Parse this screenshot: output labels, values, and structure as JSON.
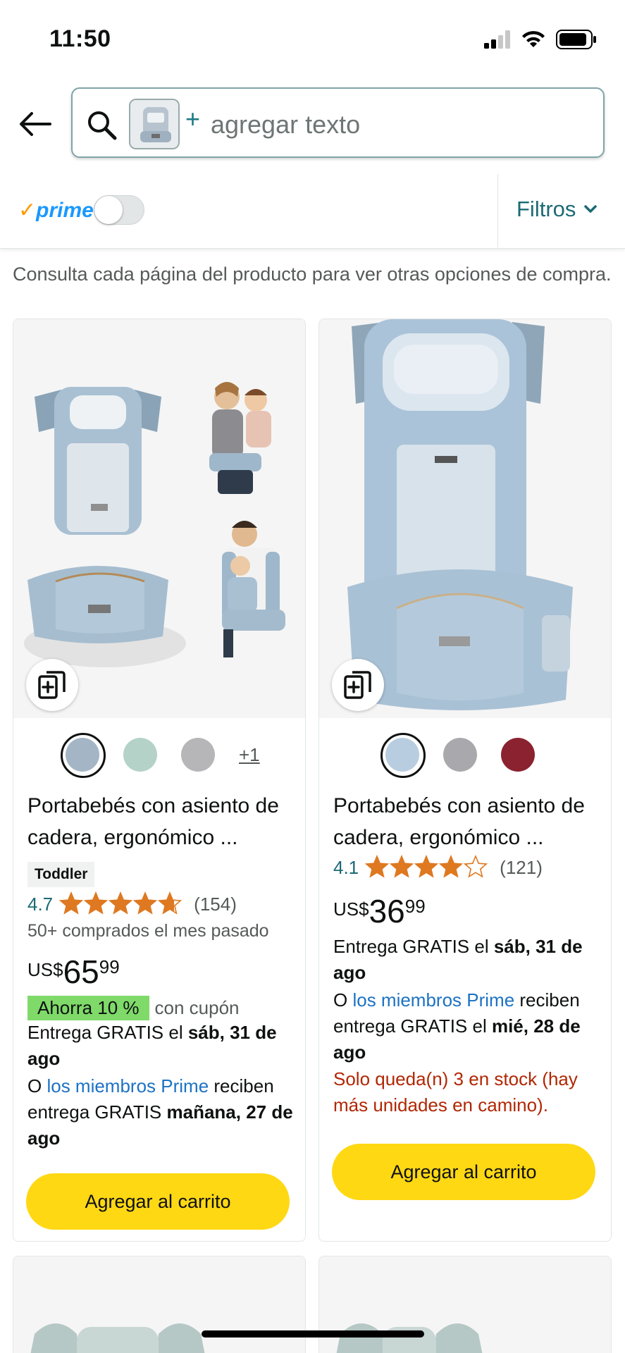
{
  "status_bar": {
    "time": "11:50"
  },
  "search": {
    "placeholder": "agregar texto",
    "plus": "+"
  },
  "filter_bar": {
    "prime_check": "✓",
    "prime_label": "prime",
    "filters_label": "Filtros",
    "prime_toggle_on": false
  },
  "info_text": "Consulta cada página del producto para ver otras opciones de compra.",
  "products": [
    {
      "title": "Portabebés con asiento de cadera, ergonómico ...",
      "badge": "Toddler",
      "rating": 4.7,
      "rating_text": "4.7",
      "review_count": "(154)",
      "bought": "50+ comprados el mes pasado",
      "price_currency": "US$",
      "price_whole": "65",
      "price_fraction": "99",
      "coupon_label": "Ahorra 10 %",
      "coupon_suffix": "con cupón",
      "delivery_prefix": "Entrega GRATIS el ",
      "delivery_date": "sáb, 31 de ago",
      "prime_prefix": "O ",
      "prime_link": "los miembros Prime",
      "prime_mid": " reciben entrega GRATIS ",
      "prime_date": "mañana, 27 de ago",
      "swatch_colors": [
        "#a4b6c6",
        "#b4d2c8",
        "#b6b6b8"
      ],
      "swatch_more": "+1",
      "cart_label": "Agregar al carrito"
    },
    {
      "title": "Portabebés con asiento de cadera, ergonómico ...",
      "rating": 4.1,
      "rating_text": "4.1",
      "review_count": "(121)",
      "price_currency": "US$",
      "price_whole": "36",
      "price_fraction": "99",
      "delivery_prefix": "Entrega GRATIS el ",
      "delivery_date": "sáb, 31 de ago",
      "prime_prefix": "O ",
      "prime_link": "los miembros Prime",
      "prime_mid": " reciben entrega GRATIS el ",
      "prime_date": "mié, 28 de ago",
      "stock": "Solo queda(n) 3 en stock (hay más unidades en camino).",
      "swatch_colors": [
        "#b9cde0",
        "#a9a9ad",
        "#8a2230"
      ],
      "cart_label": "Agregar al carrito"
    }
  ],
  "colors": {
    "cart_button": "#ffd814",
    "coupon": "#7fda69",
    "link": "#1c72c4",
    "rating_teal": "#1c6a75",
    "star": "#de7921",
    "stock_red": "#b12704",
    "prime_blue": "#1a98ff"
  }
}
